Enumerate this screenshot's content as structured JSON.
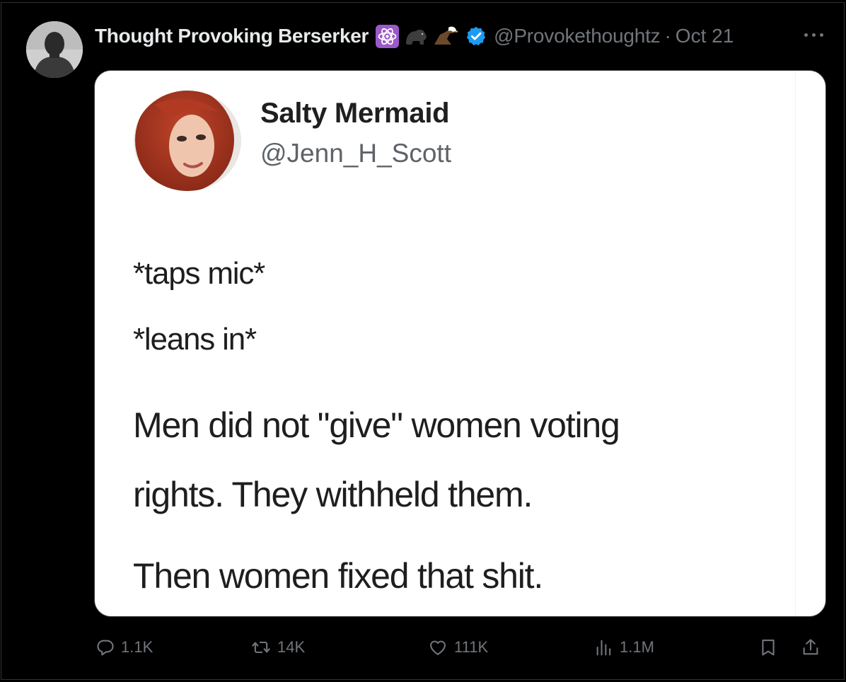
{
  "post": {
    "author_name": "Thought Provoking Berserker",
    "author_handle": "@Provokethoughtz",
    "separator": "·",
    "date": "Oct 21"
  },
  "embedded": {
    "name": "Salty Mermaid",
    "handle": "@Jenn_H_Scott",
    "lines": [
      "*taps mic*",
      "*leans in*",
      "Men did not \"give\" women voting",
      "rights. They withheld them.",
      "Then women fixed that shit."
    ]
  },
  "actions": {
    "replies": "1.1K",
    "reposts": "14K",
    "likes": "111K",
    "views": "1.1M"
  },
  "colors": {
    "background": "#000000",
    "name_text": "#e7e9ea",
    "muted_text": "#71767b",
    "verified": "#1d9bf0"
  },
  "icons": [
    "atom-emoji",
    "gorilla-emoji",
    "eagle-emoji",
    "verified-badge-icon",
    "more-icon",
    "reply-icon",
    "retweet-icon",
    "heart-icon",
    "views-icon",
    "bookmark-icon",
    "share-icon"
  ]
}
